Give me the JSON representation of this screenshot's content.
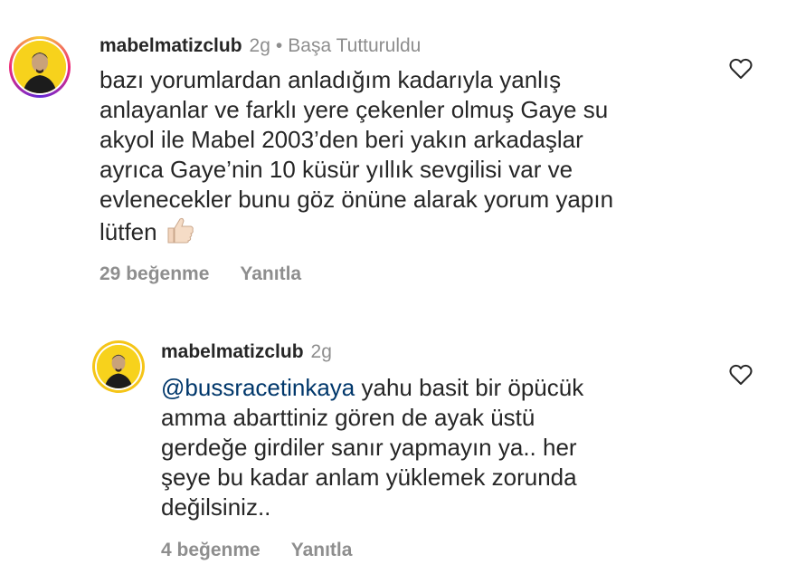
{
  "comments": [
    {
      "username": "mabelmatizclub",
      "time": "2g",
      "separator": "•",
      "pinned_label": "Başa Tutturuldu",
      "text_lines": [
        "bazı yorumlardan anladığım kadarıyla yanlış",
        "anlayanlar ve farklı yere çekenler olmuş Gaye su",
        "akyol ile Mabel 2003’den beri yakın arkadaşlar",
        "ayrıca Gaye’nin 10 küsür yıllık sevgilisi var ve",
        "evlenecekler bunu göz önüne alarak yorum yapın",
        "lütfen"
      ],
      "emoji": "👍🏻",
      "likes": "29 beğenme",
      "reply_label": "Yanıtla"
    },
    {
      "username": "mabelmatizclub",
      "time": "2g",
      "mention": "@bussracetinkaya",
      "text_lines": [
        " yahu basit bir öpücük",
        "amma abarttiniz gören de ayak üstü",
        "gerdeğe girdiler sanır yapmayın ya.. her",
        "şeye bu kadar anlam yüklemek zorunda",
        "değilsiniz.."
      ],
      "likes": "4 beğenme",
      "reply_label": "Yanıtla"
    }
  ],
  "icons": {
    "like": "heart-outline-icon",
    "avatar_ring_color_1": "#ee2a7b",
    "avatar_bg": "#f7d21c"
  },
  "colors": {
    "text": "#262626",
    "muted": "#8e8e8e",
    "mention": "#00376b"
  }
}
